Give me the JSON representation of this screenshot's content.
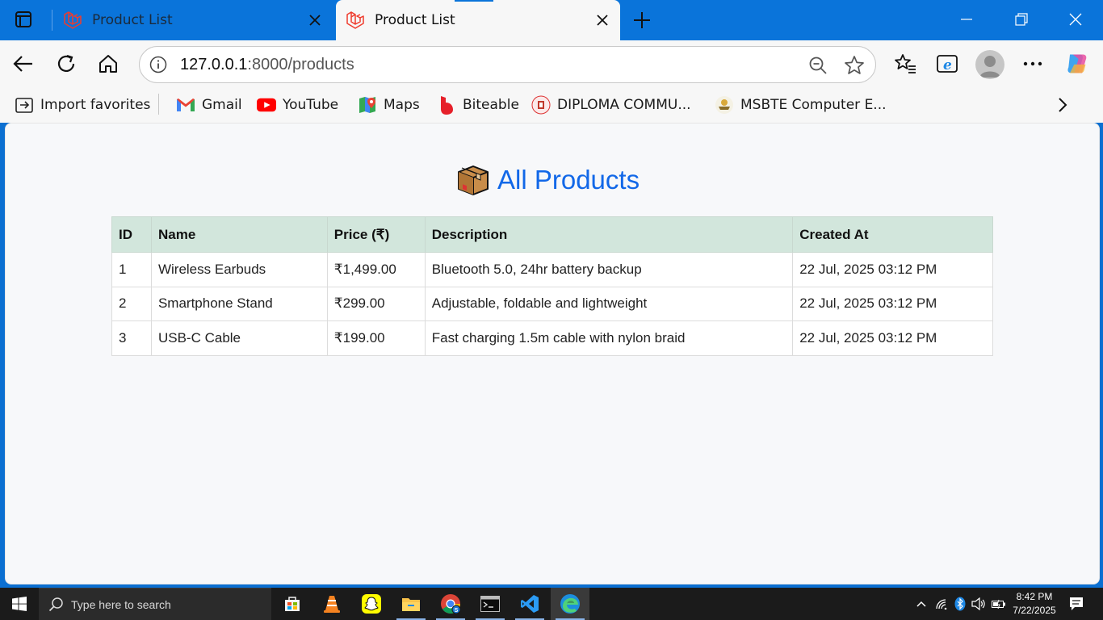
{
  "browser": {
    "tabs": [
      {
        "title": "Product List",
        "active": false
      },
      {
        "title": "Product List",
        "active": true
      }
    ],
    "url": {
      "host": "127.0.0.1",
      "rest": ":8000/products"
    }
  },
  "favorites": [
    {
      "label": "Import favorites",
      "icon": "import-favorites-icon"
    },
    {
      "label": "Gmail",
      "icon": "gmail-icon"
    },
    {
      "label": "YouTube",
      "icon": "youtube-icon"
    },
    {
      "label": "Maps",
      "icon": "maps-icon"
    },
    {
      "label": "Biteable",
      "icon": "biteable-icon"
    },
    {
      "label": "DIPLOMA COMMU...",
      "icon": "diploma-site-icon"
    },
    {
      "label": "MSBTE Computer E...",
      "icon": "msbte-site-icon"
    }
  ],
  "page": {
    "title": "All Products",
    "title_icon": "package-icon",
    "table": {
      "headers": [
        "ID",
        "Name",
        "Price (₹)",
        "Description",
        "Created At"
      ],
      "rows": [
        [
          "1",
          "Wireless Earbuds",
          "₹1,499.00",
          "Bluetooth 5.0, 24hr battery backup",
          "22 Jul, 2025 03:12 PM"
        ],
        [
          "2",
          "Smartphone Stand",
          "₹299.00",
          "Adjustable, foldable and lightweight",
          "22 Jul, 2025 03:12 PM"
        ],
        [
          "3",
          "USB-C Cable",
          "₹199.00",
          "Fast charging 1.5m cable with nylon braid",
          "22 Jul, 2025 03:12 PM"
        ]
      ]
    }
  },
  "taskbar": {
    "search_placeholder": "Type here to search",
    "time": "8:42 PM",
    "date": "7/22/2025"
  },
  "colors": {
    "titlebar": "#0a74da",
    "accent": "#1268e8",
    "table_header": "#d2e6dc"
  }
}
